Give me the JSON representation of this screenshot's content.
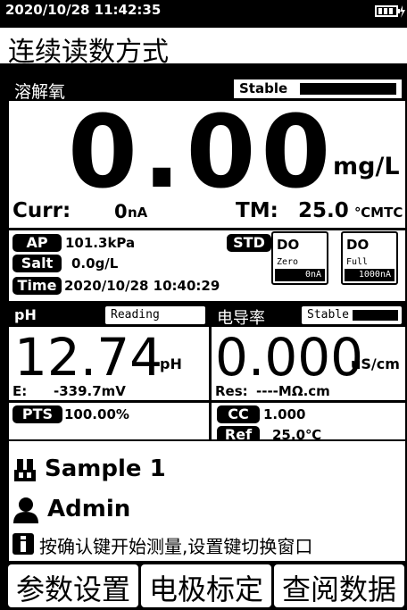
{
  "status_bar": {
    "datetime": "2020/10/28 11:42:35",
    "battery_icon": "battery-charging-icon"
  },
  "page_title": "连续读数方式",
  "do_panel": {
    "title": "溶解氧",
    "status": "Stable",
    "value": "0.00",
    "unit": "mg/L",
    "curr_label": "Curr:",
    "curr_value": "0",
    "curr_unit": "nA",
    "tm_label": "TM:",
    "tm_value": "25.0",
    "tm_unit": "℃MTC",
    "ap_label": "AP",
    "ap_value": "101.3kPa",
    "salt_label": "Salt",
    "salt_value": "0.0g/L",
    "time_label": "Time",
    "time_value": "2020/10/28  10:40:29",
    "std_label": "STD",
    "std_zero": {
      "title": "DO",
      "sub": "Zero",
      "value": "0nA"
    },
    "std_full": {
      "title": "DO",
      "sub": "Full",
      "value": "1000nA"
    }
  },
  "ph_panel": {
    "title": "pH",
    "status": "Reading",
    "value": "12.74",
    "unit": "pH",
    "e_label": "E:",
    "e_value": "-339.7mV",
    "pts_label": "PTS",
    "pts_value": "100.00%"
  },
  "cond_panel": {
    "title": "电导率",
    "status": "Stable",
    "value": "0.000",
    "unit": "uS/cm",
    "res_label": "Res:",
    "res_value": "----MΩ.cm",
    "cc_label": "CC",
    "cc_value": "1.000",
    "ref_label": "Ref",
    "ref_value": "25.0℃"
  },
  "info": {
    "sample": "Sample 1",
    "user": "Admin",
    "hint": "按确认键开始测量,设置键切换窗口"
  },
  "softkeys": {
    "left": "参数设置",
    "middle": "电极标定",
    "right": "查阅数据"
  }
}
